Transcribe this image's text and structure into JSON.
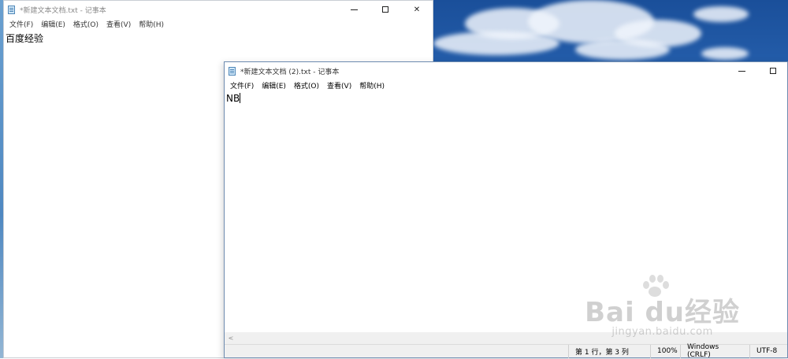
{
  "background_window": {
    "title": "*新建文本文档.txt - 记事本",
    "menu": [
      "文件(F)",
      "编辑(E)",
      "格式(O)",
      "查看(V)",
      "帮助(H)"
    ],
    "content": "百度经验"
  },
  "active_window": {
    "title": "*新建文本文档 (2).txt - 记事本",
    "menu": [
      "文件(F)",
      "编辑(E)",
      "格式(O)",
      "查看(V)",
      "帮助(H)"
    ],
    "content": "NB",
    "status": {
      "position": "第 1 行，第 3 列",
      "zoom": "100%",
      "line_ending": "Windows (CRLF)",
      "encoding": "UTF-8"
    }
  },
  "watermark": {
    "main": "Bai du经验",
    "sub": "jingyan.baidu.com"
  },
  "colors": {
    "sky": "#2d6ab9",
    "statusbar": "#f0f0f0",
    "window_border": "#6d8bb0"
  }
}
